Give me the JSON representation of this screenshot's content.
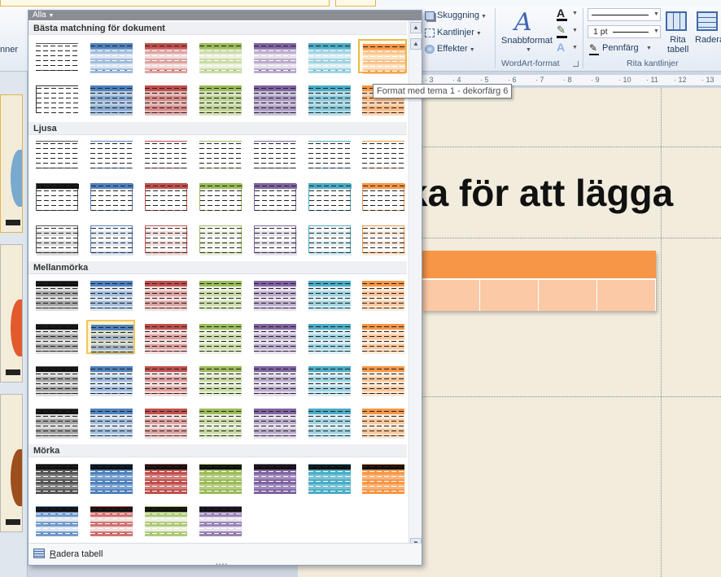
{
  "ribbon": {
    "partial_left_label": "nner",
    "shape_effects": [
      {
        "label": "Skuggning",
        "icon": "shadow-icon"
      },
      {
        "label": "Kantlinjer",
        "icon": "border-icon"
      },
      {
        "label": "Effekter",
        "icon": "effects-icon"
      }
    ],
    "quick_styles_label": "Snabbformat",
    "wordart_group_label": "WordArt-format",
    "line_weight_value": "1 pt",
    "pen_color_label": "Pennfärg",
    "draw_table_label": "Rita tabell",
    "eraser_label": "Radera",
    "draw_borders_group_label": "Rita kantlinjer"
  },
  "slide": {
    "title_fragment": "ka för att lägga",
    "table_color": "#f79646",
    "ruler_ticks": [
      "3",
      "4",
      "5",
      "6",
      "7",
      "8",
      "9",
      "10",
      "11",
      "12",
      "13"
    ]
  },
  "gallery": {
    "filter_label": "Alla",
    "sections": [
      {
        "title": "Bästa matchning för dokument",
        "rows": 2
      },
      {
        "title": "Ljusa",
        "rows": 3
      },
      {
        "title": "Mellanmörka",
        "rows": 4
      },
      {
        "title": "Mörka",
        "rows": 2
      }
    ],
    "theme_colors": [
      "#555555",
      "#4f81bd",
      "#c0504d",
      "#9bbb59",
      "#8064a2",
      "#4bacc6",
      "#f79646"
    ],
    "footer_clear_label_underlined": "R",
    "footer_clear_label_rest": "adera tabell"
  },
  "tooltip": "Format med tema 1 - dekorfärg 6"
}
